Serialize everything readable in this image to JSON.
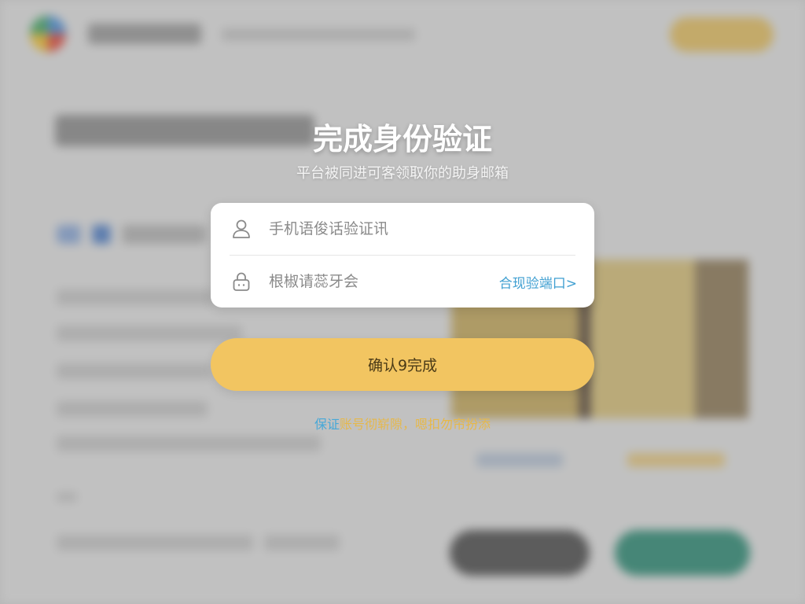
{
  "modal": {
    "title": "完成身份验证",
    "subtitle": "平台被同进可客领取你的助身邮箱",
    "phone_field": {
      "placeholder": "手机语俊话验证讯",
      "icon": "user-icon"
    },
    "code_field": {
      "placeholder": "根椒请蕊牙会",
      "icon": "lock-icon",
      "get_code_label": "合现验端口>"
    },
    "confirm_label": "确认9完成",
    "notice": {
      "link_text": "保证",
      "text": "账号彻崭隙，嗯扣勿帘扮添"
    }
  },
  "colors": {
    "button": "#f2c561",
    "link": "#3f9fd1",
    "notice_text": "#e6b84a"
  }
}
